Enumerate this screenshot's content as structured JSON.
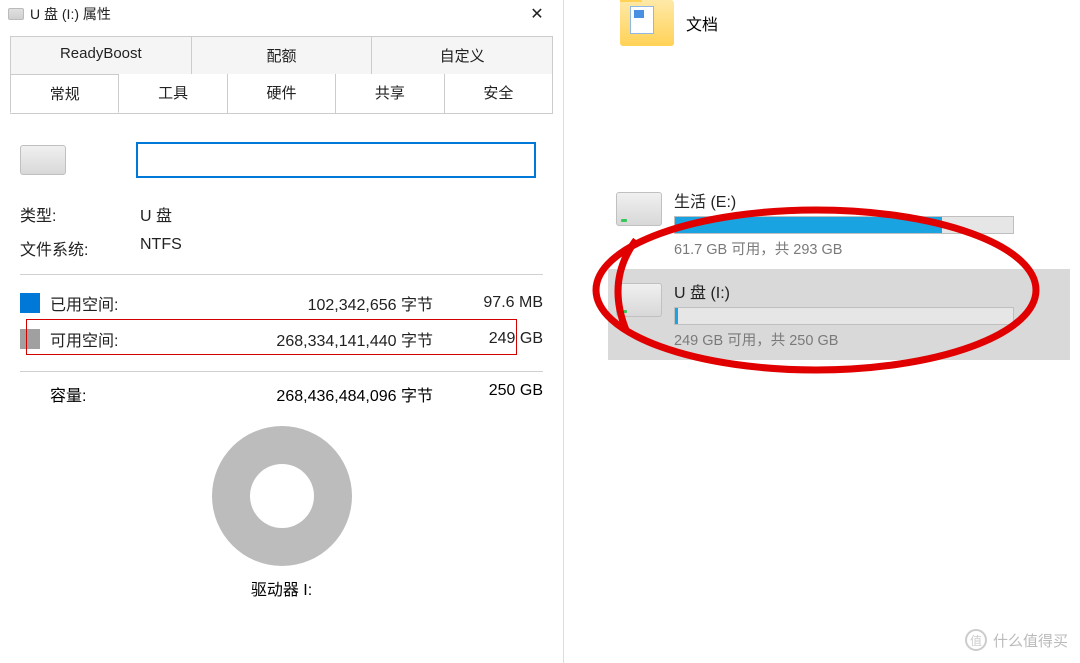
{
  "dialog": {
    "title": "U 盘 (I:) 属性",
    "close_glyph": "✕",
    "tabs_row1": [
      "ReadyBoost",
      "配额",
      "自定义"
    ],
    "tabs_row2": [
      "常规",
      "工具",
      "硬件",
      "共享",
      "安全"
    ],
    "active_tab": "常规",
    "name_value": "",
    "type_label": "类型:",
    "type_value": "U 盘",
    "fs_label": "文件系统:",
    "fs_value": "NTFS",
    "used": {
      "label": "已用空间:",
      "bytes": "102,342,656 字节",
      "human": "97.6 MB"
    },
    "free": {
      "label": "可用空间:",
      "bytes": "268,334,141,440 字节",
      "human": "249 GB"
    },
    "capacity": {
      "label": "容量:",
      "bytes": "268,436,484,096 字节",
      "human": "250 GB"
    },
    "drive_label": "驱动器 I:",
    "colors": {
      "used": "#0078d7",
      "free": "#a0a0a0",
      "accent": "#0078d7"
    }
  },
  "explorer": {
    "folder": {
      "name": "文档"
    },
    "drives": [
      {
        "name": "生活 (E:)",
        "sub": "61.7 GB 可用，共 293 GB",
        "fill_pct": 79,
        "selected": false
      },
      {
        "name": "U 盘 (I:)",
        "sub": "249 GB 可用，共 250 GB",
        "fill_pct": 1,
        "selected": true
      }
    ]
  },
  "watermark": {
    "symbol": "值",
    "text": "什么值得买"
  }
}
